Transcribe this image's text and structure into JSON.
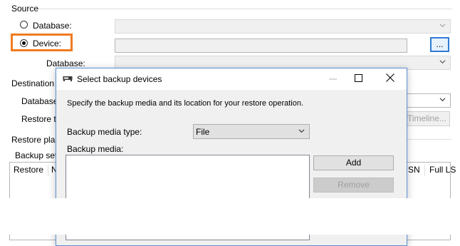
{
  "source": {
    "group_label": "Source",
    "database_radio_label": "Database:",
    "device_radio_label": "Device:",
    "database_sub_label": "Database:",
    "browse_button_label": "..."
  },
  "destination": {
    "group_label": "Destination",
    "database_label": "Database:",
    "restore_to_label": "Restore to",
    "timeline_button_label": "Timeline..."
  },
  "restore_plan": {
    "group_label": "Restore plan",
    "backup_sets_label": "Backup sets",
    "columns": [
      "Restore",
      "N",
      "SN",
      "Full LS"
    ]
  },
  "dialog": {
    "title": "Select backup devices",
    "instructions": "Specify the backup media and its location for your restore operation.",
    "media_type_label": "Backup media type:",
    "media_type_value": "File",
    "media_label": "Backup media:",
    "add_button_label": "Add",
    "remove_button_label": "Remove"
  },
  "colors": {
    "highlight_box": "#f07b22",
    "dialog_border": "#5b8fd1"
  }
}
